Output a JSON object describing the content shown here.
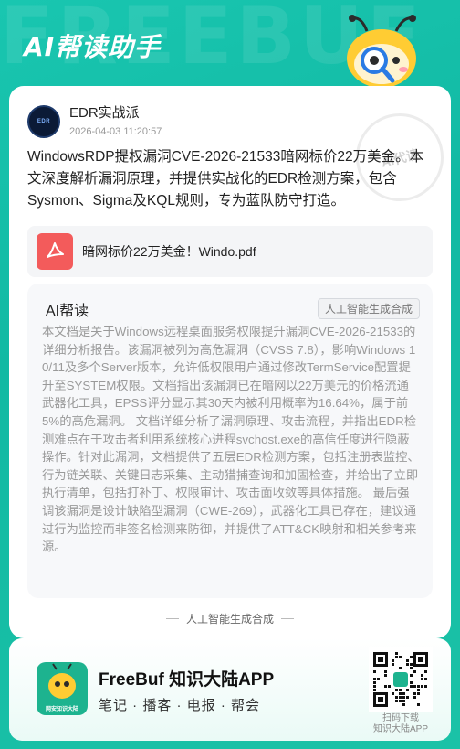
{
  "header": {
    "watermark": "FREEBUF",
    "title": "AI帮读助手"
  },
  "post": {
    "author_name": "EDR实战派",
    "avatar_text": "EDR",
    "timestamp": "2026-04-03 11:20:57",
    "summary": "WindowsRDP提权漏洞CVE-2026-21533暗网标价22万美金。本文深度解析漏洞原理，并提供实战化的EDR检测方案，包含Sysmon、Sigma及KQL规则，专为蓝队防守打造。",
    "stamp_text": "AI代读",
    "attachment": "暗网标价22万美金！Windo.pdf"
  },
  "ai_read": {
    "title": "AI帮读",
    "badge": "人工智能生成合成",
    "content": "本文档是关于Windows远程桌面服务权限提升漏洞CVE-2026-21533的详细分析报告。该漏洞被列为高危漏洞（CVSS 7.8），影响Windows 10/11及多个Server版本，允许低权限用户通过修改TermService配置提升至SYSTEM权限。文档指出该漏洞已在暗网以22万美元的价格流通武器化工具，EPSS评分显示其30天内被利用概率为16.64%，属于前5%的高危漏洞。 文档详细分析了漏洞原理、攻击流程，并指出EDR检测难点在于攻击者利用系统核心进程svchost.exe的高信任度进行隐蔽操作。针对此漏洞，文档提供了五层EDR检测方案，包括注册表监控、行为链关联、关键日志采集、主动猎捕查询和加固检查，并给出了立即执行清单，包括打补丁、权限审计、攻击面收敛等具体措施。 最后强调该漏洞是设计缺陷型漏洞（CWE-269），武器化工具已存在，建议通过行为监控而非签名检测来防御，并提供了ATT&CK映射和相关参考来源。"
  },
  "card_footer": "人工智能生成合成",
  "app": {
    "icon_label": "网安知识大陆",
    "title": "FreeBuf 知识大陆APP",
    "tags": "笔记 · 播客 · 电报 · 帮会",
    "qr_caption_1": "扫码下载",
    "qr_caption_2": "知识大陆APP"
  },
  "colors": {
    "brand": "#12b9a3",
    "pdf_red": "#f35b5b"
  }
}
